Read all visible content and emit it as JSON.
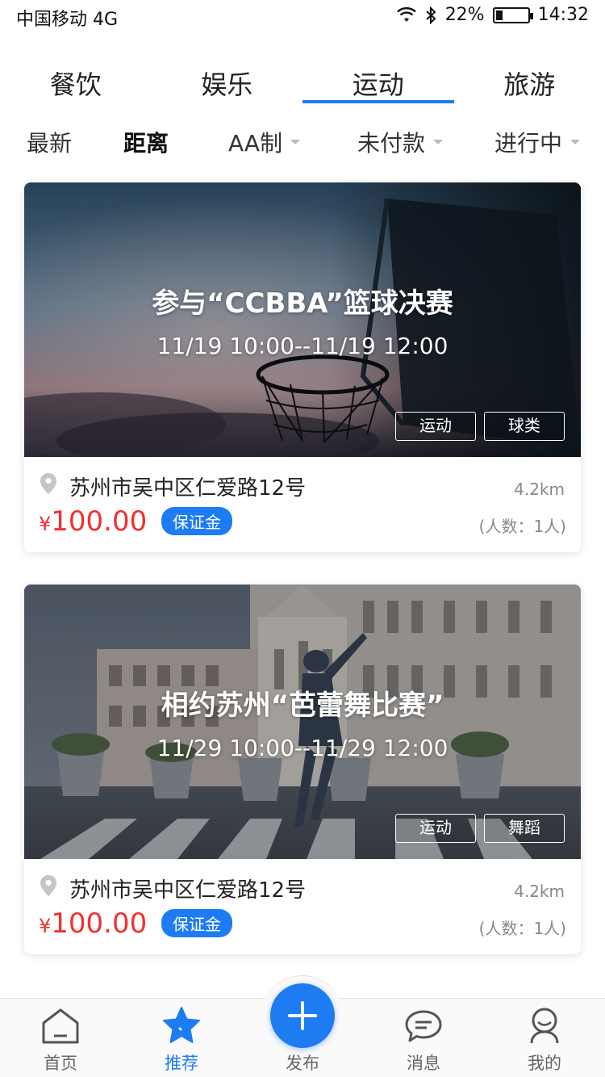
{
  "status": {
    "carrier": "中国移动 4G",
    "battery": "22%",
    "battery_level": 0.22,
    "time": "14:32"
  },
  "tabs": [
    {
      "label": "餐饮"
    },
    {
      "label": "娱乐"
    },
    {
      "label": "运动",
      "active": true
    },
    {
      "label": "旅游"
    }
  ],
  "filters": {
    "latest": "最新",
    "distance": "距离",
    "aa": "AA制",
    "unpaid": "未付款",
    "ongoing": "进行中"
  },
  "cards": [
    {
      "title": "参与“CCBBA”篮球决赛",
      "time": "11/19 10:00--11/19 12:00",
      "tags": [
        "运动",
        "球类"
      ],
      "address": "苏州市吴中区仁爱路12号",
      "distance": "4.2km",
      "currency": "¥",
      "price": "100.00",
      "deposit": "保证金",
      "people": "(人数：1人)"
    },
    {
      "title": "相约苏州“芭蕾舞比赛”",
      "time": "11/29 10:00--11/29 12:00",
      "tags": [
        "运动",
        "舞蹈"
      ],
      "address": "苏州市吴中区仁爱路12号",
      "distance": "4.2km",
      "currency": "¥",
      "price": "100.00",
      "deposit": "保证金",
      "people": "(人数：1人)"
    }
  ],
  "nav": {
    "home": "首页",
    "recommend": "推荐",
    "publish": "发布",
    "messages": "消息",
    "mine": "我的"
  },
  "colors": {
    "accent": "#1e7cf2",
    "price": "#f23030"
  },
  "icons": {
    "location": "location-pin-icon",
    "home": "home-icon",
    "recommend": "star-icon",
    "publish": "plus-icon",
    "messages": "chat-bubble-icon",
    "mine": "user-icon"
  }
}
